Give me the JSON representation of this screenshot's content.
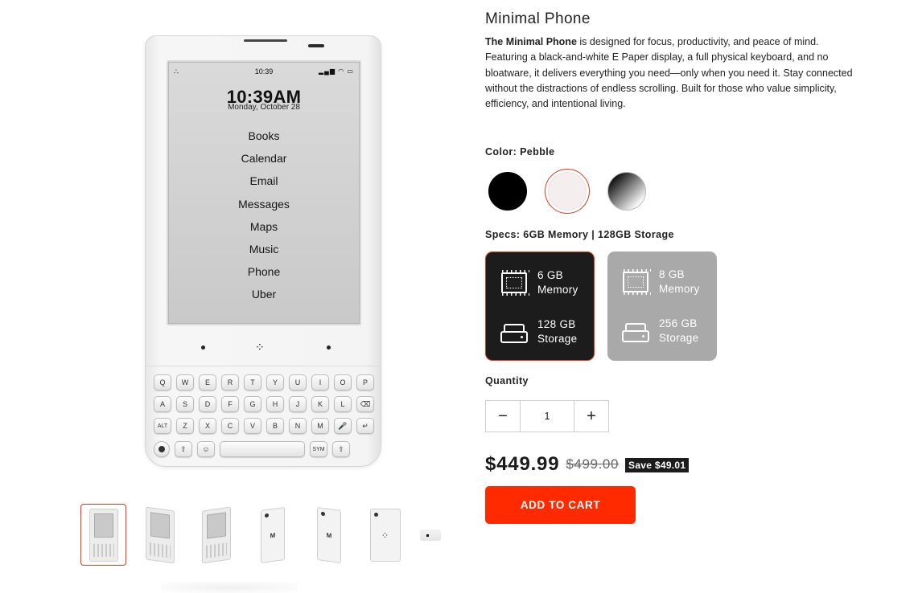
{
  "phone_screen": {
    "status_time": "10:39",
    "clock": "10:39AM",
    "date": "Monday, October 28",
    "apps": [
      "Books",
      "Calendar",
      "Email",
      "Messages",
      "Maps",
      "Music",
      "Phone",
      "Uber"
    ]
  },
  "keyboard": {
    "row1": [
      "Q",
      "W",
      "E",
      "R",
      "T",
      "Y",
      "U",
      "I",
      "O",
      "P"
    ],
    "row2": [
      "A",
      "S",
      "D",
      "F",
      "G",
      "H",
      "J",
      "K",
      "L",
      "⌫"
    ],
    "row3": [
      "ALT",
      "Z",
      "X",
      "C",
      "V",
      "B",
      "N",
      "M",
      "🎤",
      "↵"
    ],
    "row4_left": [
      "⇧",
      "☺"
    ],
    "row4_right": [
      "SYM",
      "⇧"
    ]
  },
  "product": {
    "title": "Minimal Phone",
    "description_bold": "The Minimal Phone",
    "description_rest": " is designed for focus, productivity, and peace of mind. Featuring a black-and-white E Paper display, a full physical keyboard, and no bloatware, it delivers everything you need—only when you need it. Stay connected without the distractions of endless scrolling. Built for those who value simplicity, efficiency, and intentional living."
  },
  "color": {
    "label": "Color: Pebble",
    "swatches": [
      {
        "name": "Black",
        "color": "#000000",
        "selected": false
      },
      {
        "name": "Pebble",
        "color": "#f4eeee",
        "selected": true
      },
      {
        "name": "Gradient",
        "color": "linear-gradient(135deg,#000,#fff)",
        "selected": false
      }
    ]
  },
  "specs": {
    "label": "Specs: 6GB Memory | 128GB Storage",
    "options": [
      {
        "memory": "6 GB\nMemory",
        "storage": "128 GB\nStorage",
        "selected": true
      },
      {
        "memory": "8 GB\nMemory",
        "storage": "256 GB\nStorage",
        "selected": false
      }
    ]
  },
  "quantity": {
    "label": "Quantity",
    "minus": "−",
    "value": "1",
    "plus": "+"
  },
  "pricing": {
    "price": "$449.99",
    "compare_at": "$499.00",
    "save_badge": "Save $49.01"
  },
  "cart": {
    "button": "ADD TO CART"
  },
  "colors": {
    "accent": "#ff2a00",
    "selected_border": "#e03b1a",
    "dark": "#1c1c1c"
  }
}
